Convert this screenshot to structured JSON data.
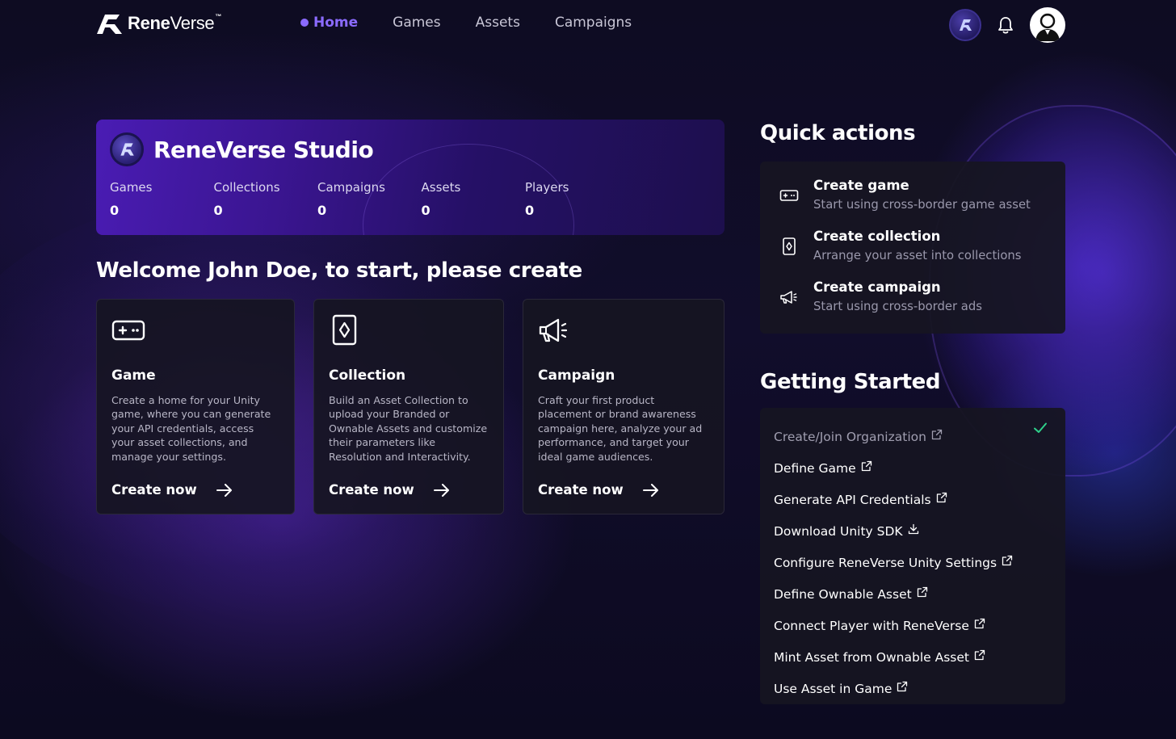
{
  "brand": {
    "name_bold": "Rene",
    "name_light": "Verse",
    "tm": "™"
  },
  "nav": {
    "links": [
      {
        "label": "Home",
        "active": true
      },
      {
        "label": "Games",
        "active": false
      },
      {
        "label": "Assets",
        "active": false
      },
      {
        "label": "Campaigns",
        "active": false
      }
    ],
    "icons": [
      "reneverse-token-icon",
      "bell-icon",
      "user-avatar-icon"
    ]
  },
  "studio": {
    "title": "ReneVerse Studio",
    "stats": [
      {
        "label": "Games",
        "value": "0"
      },
      {
        "label": "Collections",
        "value": "0"
      },
      {
        "label": "Campaigns",
        "value": "0"
      },
      {
        "label": "Assets",
        "value": "0"
      },
      {
        "label": "Players",
        "value": "0"
      }
    ]
  },
  "welcome": "Welcome John Doe, to start, please create",
  "cards": [
    {
      "icon": "gamepad-icon",
      "title": "Game",
      "description": "Create a home for your Unity game, where you can generate your API credentials, access your asset collections, and manage your settings.",
      "cta": "Create now"
    },
    {
      "icon": "card-diamond-icon",
      "title": "Collection",
      "description": "Build an Asset Collection to upload your Branded or Ownable Assets and customize their parameters like Resolution and Interactivity.",
      "cta": "Create now"
    },
    {
      "icon": "megaphone-icon",
      "title": "Campaign",
      "description": "Craft your first product placement or brand awareness campaign here, analyze your ad performance, and target your ideal game audiences.",
      "cta": "Create now"
    }
  ],
  "quick_actions": {
    "title": "Quick actions",
    "items": [
      {
        "icon": "gamepad-icon",
        "label": "Create game",
        "sub": "Start using cross-border game asset"
      },
      {
        "icon": "card-diamond-icon",
        "label": "Create collection",
        "sub": "Arrange your asset into collections"
      },
      {
        "icon": "megaphone-icon",
        "label": "Create campaign",
        "sub": "Start using cross-border ads"
      }
    ]
  },
  "getting_started": {
    "title": "Getting Started",
    "items": [
      {
        "label": "Create/Join Organization",
        "icon": "external-link-icon",
        "done": true
      },
      {
        "label": "Define Game",
        "icon": "external-link-icon",
        "done": false
      },
      {
        "label": "Generate API Credentials",
        "icon": "external-link-icon",
        "done": false
      },
      {
        "label": "Download Unity SDK",
        "icon": "download-icon",
        "done": false
      },
      {
        "label": "Configure ReneVerse Unity Settings",
        "icon": "external-link-icon",
        "done": false
      },
      {
        "label": "Define Ownable Asset",
        "icon": "external-link-icon",
        "done": false
      },
      {
        "label": "Connect Player with ReneVerse",
        "icon": "external-link-icon",
        "done": false
      },
      {
        "label": "Mint Asset from Ownable Asset",
        "icon": "external-link-icon",
        "done": false
      },
      {
        "label": "Use Asset in Game",
        "icon": "external-link-icon",
        "done": false
      }
    ]
  },
  "colors": {
    "accent": "#8b6bff",
    "check": "#2fd18b",
    "card_bg": "#161522"
  }
}
